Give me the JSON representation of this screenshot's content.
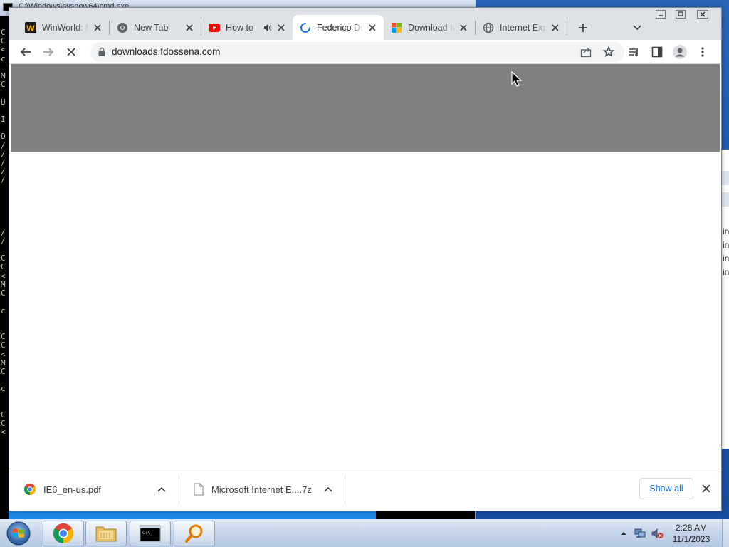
{
  "cmd": {
    "title": "C:\\Windows\\sysnow64\\cmd.exe",
    "text": "C\nC\n<\nc\n\nM\nC\n\nU\n\nI\n\nO\n/\n/\n/\n/\n/\n\n\n\n\n\n/\n/\n\nC\nC\n<\nM\nC\n\nc\n\n\nC\nC\n<\nM\nC\n\nc\n\n\nC\nC\n<"
  },
  "right_window": {
    "lines": [
      "in",
      "in",
      "in",
      "in"
    ]
  },
  "tabs": [
    {
      "title": "WinWorld: Mi",
      "favicon": "winworld-icon",
      "active": false,
      "audio": false
    },
    {
      "title": "New Tab",
      "favicon": "chrome-icon",
      "active": false,
      "audio": false
    },
    {
      "title": "How to",
      "favicon": "youtube-icon",
      "active": false,
      "audio": true
    },
    {
      "title": "Federico Do",
      "favicon": "loading-spinner-icon",
      "active": true,
      "audio": false
    },
    {
      "title": "Download Ic",
      "favicon": "microsoft-icon",
      "active": false,
      "audio": false
    },
    {
      "title": "Internet Exp",
      "favicon": "globe-icon",
      "active": false,
      "audio": false
    }
  ],
  "toolbar": {
    "url": "downloads.fdossena.com"
  },
  "downloads": [
    {
      "name": "IE6_en-us.pdf",
      "icon": "chrome-pdf-icon"
    },
    {
      "name": "Microsoft Internet E....7z",
      "icon": "file-icon"
    }
  ],
  "download_shelf": {
    "show_all_label": "Show all"
  },
  "clock": {
    "time": "2:28 AM",
    "date": "11/1/2023"
  },
  "colors": {
    "banner": "#808080",
    "accent": "#1a73e8",
    "tabstrip": "#dee1e6"
  }
}
